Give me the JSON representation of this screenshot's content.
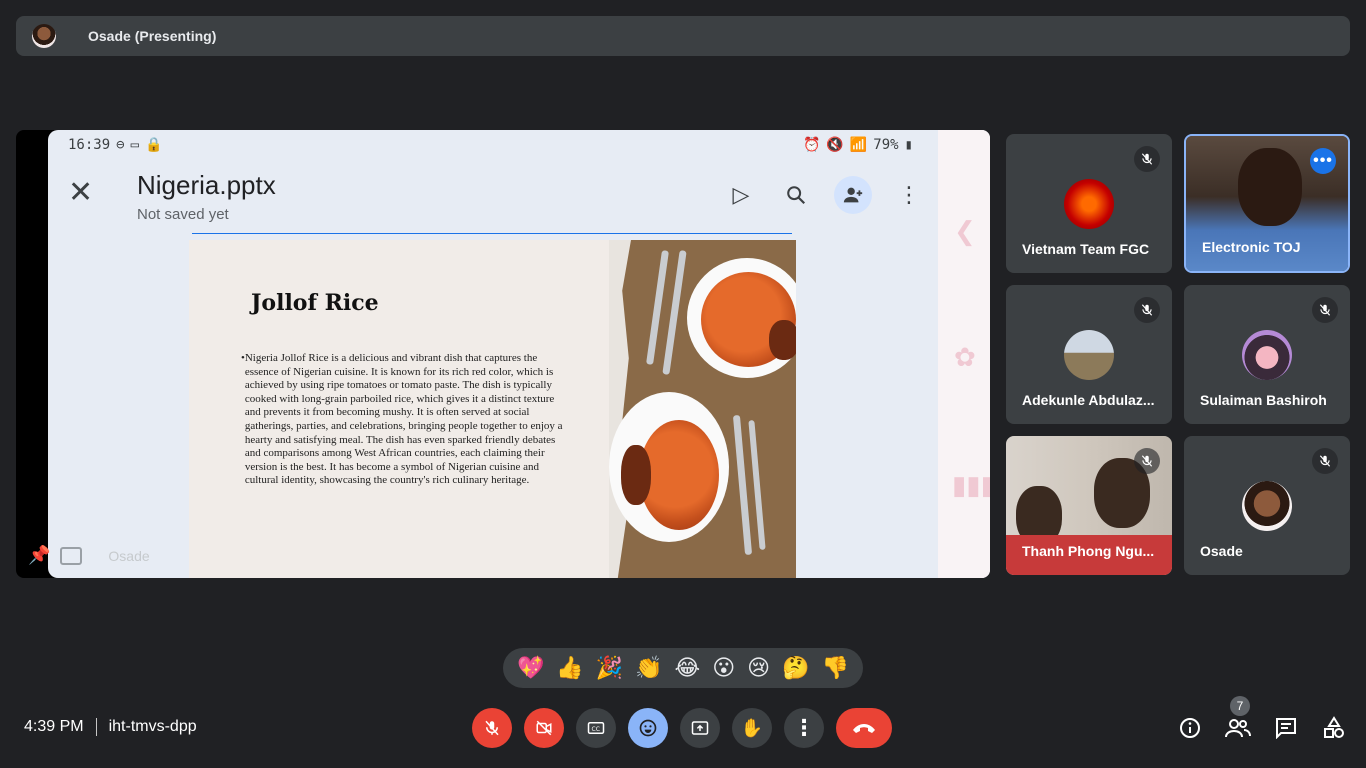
{
  "presenter_bar": {
    "title": "Osade (Presenting)"
  },
  "screen": {
    "status_time": "16:39",
    "status_battery": "79%",
    "doc_title": "Nigeria.pptx",
    "doc_status": "Not saved yet",
    "slide": {
      "title": "Jollof Rice",
      "body": "Nigeria Jollof Rice is a delicious and vibrant dish that captures the essence of Nigerian cuisine. It is known for its rich red color, which is achieved by using ripe tomatoes or tomato paste. The dish is typically cooked with long-grain parboiled rice, which gives it a distinct texture and prevents it from becoming mushy. It is often served at social gatherings, parties, and celebrations, bringing people together to enjoy a hearty and satisfying meal. The dish has even sparked friendly debates and comparisons among West African countries, each claiming their version is the best. It has become a symbol of Nigerian cuisine and cultural identity, showcasing the country's rich culinary heritage."
    },
    "presenter_name": "Osade"
  },
  "participants": [
    {
      "name": "Vietnam Team FGC",
      "muted": true,
      "speaking": false
    },
    {
      "name": "Electronic TOJ",
      "muted": false,
      "speaking": true
    },
    {
      "name": "Adekunle Abdulaz...",
      "muted": true,
      "speaking": false
    },
    {
      "name": "Sulaiman Bashiroh",
      "muted": true,
      "speaking": false
    },
    {
      "name": "Thanh Phong Ngu...",
      "muted": true,
      "speaking": false
    },
    {
      "name": "Osade",
      "muted": true,
      "speaking": false
    }
  ],
  "reactions": [
    "💖",
    "👍",
    "🎉",
    "👏",
    "😂",
    "😮",
    "😢",
    "🤔",
    "👎"
  ],
  "bottom_bar": {
    "time": "4:39 PM",
    "meeting_code": "iht-tmvs-dpp",
    "people_count": "7"
  },
  "colors": {
    "accent": "#8ab4f8",
    "danger": "#ea4335",
    "surface": "#3c4043",
    "background": "#202124"
  }
}
